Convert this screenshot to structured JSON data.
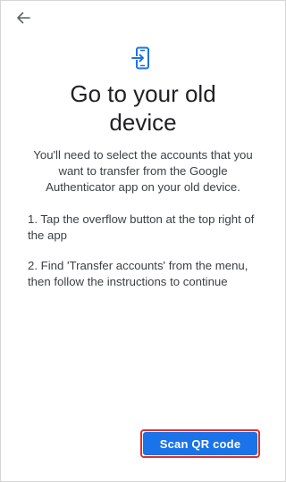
{
  "header": {
    "back_icon": "arrow-back-icon"
  },
  "hero": {
    "icon": "phone-transfer-icon",
    "icon_color": "#1a73e8"
  },
  "content": {
    "title": "Go to your old device",
    "description": "You'll need to select the accounts that you want to transfer from the Google Authenticator app on your old device.",
    "steps": [
      "1. Tap the overflow button at the top right of the app",
      "2. Find 'Transfer accounts' from the menu, then follow the instructions to continue"
    ]
  },
  "actions": {
    "scan_label": "Scan QR code",
    "scan_color": "#1a73e8",
    "highlight_color": "#e0302e"
  }
}
